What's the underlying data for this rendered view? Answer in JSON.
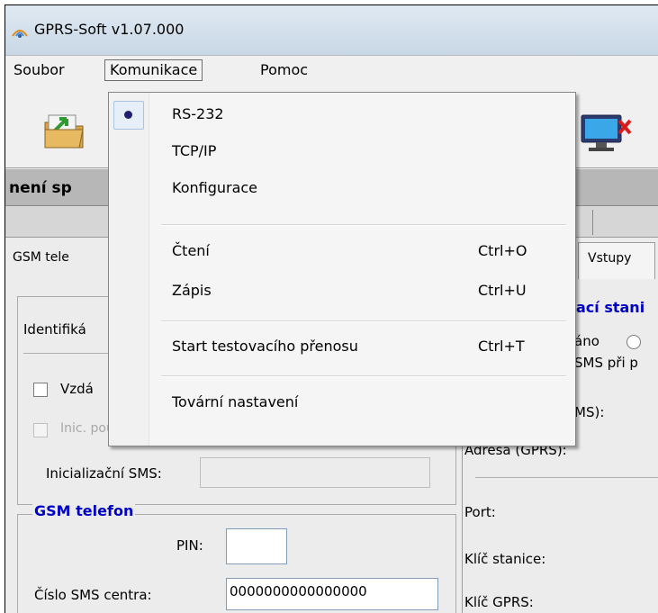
{
  "window": {
    "title": "GPRS-Soft v1.07.000"
  },
  "menubar": {
    "items": [
      "Soubor",
      "Komunikace",
      "Pomoc"
    ]
  },
  "panel": {
    "title_partial": "není sp"
  },
  "tabs": {
    "left_partial": "GSM tele",
    "right": "Vstupy"
  },
  "left": {
    "identification_partial": "Identifiká",
    "remote_checkbox_partial": "Vzdá",
    "init_only_label": "Inic. pouze ze seznamu tel.č. zasílání zpráv",
    "init_sms_label": "Inicializační SMS:",
    "init_sms_value": "",
    "gsm_group_title": "GSM telefon",
    "pin_label": "PIN:",
    "pin_value": "",
    "sms_center_label": "Číslo SMS centra:",
    "sms_center_value": "0000000000000000"
  },
  "right": {
    "group_title_partial": "ací stani",
    "radio_partial": "áno",
    "sms_partial": "SMS při p",
    "sms_label_partial": "MS):",
    "address_gprs": "Adresa (GPRS):",
    "port": "Port:",
    "station_key": "Klíč stanice:",
    "gprs_key": "Klíč GPRS:"
  },
  "dropdown": {
    "items": [
      {
        "label": "RS-232",
        "shortcut": "",
        "checked": true
      },
      {
        "label": "TCP/IP",
        "shortcut": ""
      },
      {
        "label": "Konfigurace",
        "shortcut": ""
      },
      {
        "label": "Čtení",
        "shortcut": "Ctrl+O"
      },
      {
        "label": "Zápis",
        "shortcut": "Ctrl+U"
      },
      {
        "label": "Start testovacího přenosu",
        "shortcut": "Ctrl+T"
      },
      {
        "label": "Tovární nastavení",
        "shortcut": ""
      }
    ]
  },
  "colors": {
    "group_title": "#0000c8",
    "panel_header": "#b7b7b7"
  }
}
